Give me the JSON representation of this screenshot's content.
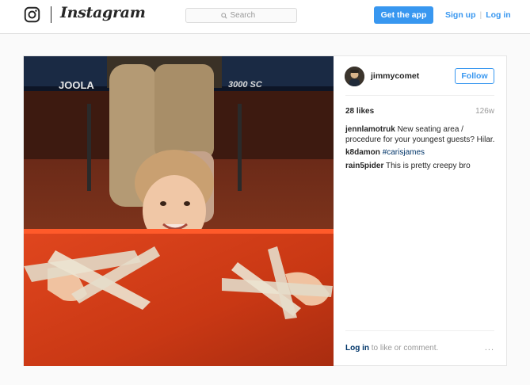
{
  "header": {
    "brand": "Instagram",
    "search_placeholder": "Search",
    "get_app_label": "Get the app",
    "signup_label": "Sign up",
    "separator": "|",
    "login_label": "Log in"
  },
  "post": {
    "author": {
      "username": "jimmycomet",
      "follow_label": "Follow"
    },
    "photo": {
      "visible_text": {
        "table_brand": "JOOLA",
        "table_model": "3000 SC"
      }
    },
    "likes": "28 likes",
    "age": "126w",
    "comments": [
      {
        "user": "jennlamotruk",
        "text": "New seating area / procedure for your youngest guests? Hilar."
      },
      {
        "user": "k8damon",
        "text": "",
        "hashtag": "#carisjames"
      },
      {
        "user": "rain5pider",
        "text": "This is pretty creepy bro"
      }
    ],
    "footer": {
      "login_link": "Log in",
      "login_suffix": "to like or comment.",
      "more_icon": "..."
    }
  },
  "colors": {
    "accent": "#3897f0",
    "link_dark": "#003569",
    "muted": "#999999",
    "border": "#dbdbdb"
  }
}
